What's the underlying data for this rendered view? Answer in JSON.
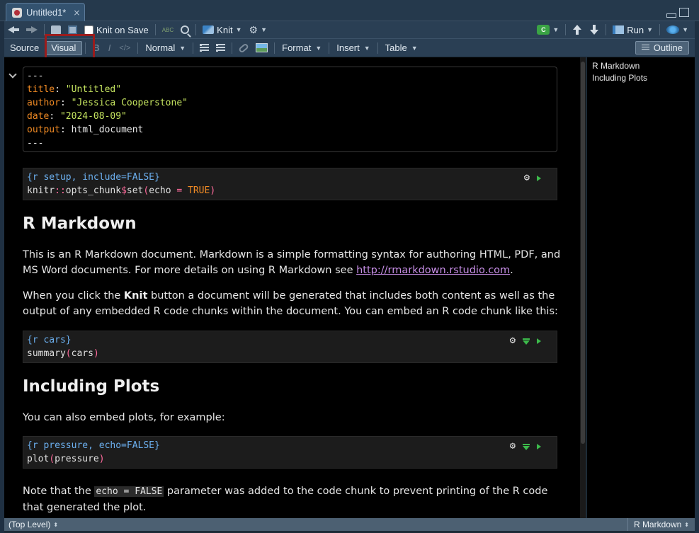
{
  "tab": {
    "title": "Untitled1*",
    "close": "×"
  },
  "toolbar": {
    "knit_on_save": "Knit on Save",
    "spell_label": "ABC",
    "knit": "Knit",
    "run": "Run",
    "chunk_badge": "C"
  },
  "format_bar": {
    "source": "Source",
    "visual": "Visual",
    "bold": "B",
    "italic": "I",
    "code": "</>",
    "style": "Normal",
    "format": "Format",
    "insert": "Insert",
    "table": "Table",
    "outline": "Outline"
  },
  "yaml": {
    "delim": "---",
    "title_key": "title",
    "title_val": "\"Untitled\"",
    "author_key": "author",
    "author_val": "\"Jessica Cooperstone\"",
    "date_key": "date",
    "date_val": "\"2024-08-09\"",
    "output_key": "output",
    "output_val": "html_document"
  },
  "chunks": [
    {
      "header": "{r setup, include=FALSE}",
      "code_a": "knitr",
      "code_b": "::",
      "code_c": "opts_chunk",
      "code_d": "$",
      "code_e": "set",
      "code_f": "(",
      "code_g": "echo ",
      "code_h": "=",
      "code_i": " TRUE",
      "code_j": ")"
    },
    {
      "header": "{r cars}",
      "code_a": "summary",
      "code_b": "(",
      "code_c": "cars",
      "code_d": ")"
    },
    {
      "header": "{r pressure, echo=FALSE}",
      "code_a": "plot",
      "code_b": "(",
      "code_c": "pressure",
      "code_d": ")"
    }
  ],
  "doc": {
    "h1": "R Markdown",
    "p1_a": "This is an R Markdown document. Markdown is a simple formatting syntax for authoring HTML, PDF, and MS Word documents. For more details on using R Markdown see ",
    "p1_link": "http://rmarkdown.rstudio.com",
    "p1_end": ".",
    "p2_a": "When you click the ",
    "p2_bold": "Knit",
    "p2_b": " button a document will be generated that includes both content as well as the output of any embedded R code chunks within the document. You can embed an R code chunk like this:",
    "h2": "Including Plots",
    "p3": "You can also embed plots, for example:",
    "p4_a": "Note that the ",
    "p4_code": "echo = FALSE",
    "p4_b": " parameter was added to the code chunk to prevent printing of the R code that generated the plot."
  },
  "outline": {
    "items": [
      "R Markdown",
      "Including Plots"
    ]
  },
  "status": {
    "left": "(Top Level)",
    "right": "R Markdown"
  },
  "colors": {
    "accent_highlight": "#9b1c1c",
    "link": "#c78ee6",
    "yaml_key": "#f08a24",
    "yaml_string": "#c4e35f",
    "chunk_header": "#6cb0f0"
  },
  "icons": [
    "back-icon",
    "forward-icon",
    "show-in-window-icon",
    "save-icon",
    "spellcheck-icon",
    "find-icon",
    "knit-icon",
    "gear-icon",
    "insert-chunk-icon",
    "up-arrow-icon",
    "down-arrow-icon",
    "run-icon",
    "publish-icon",
    "bullet-list-icon",
    "numbered-list-icon",
    "link-icon",
    "image-icon",
    "outline-icon"
  ]
}
